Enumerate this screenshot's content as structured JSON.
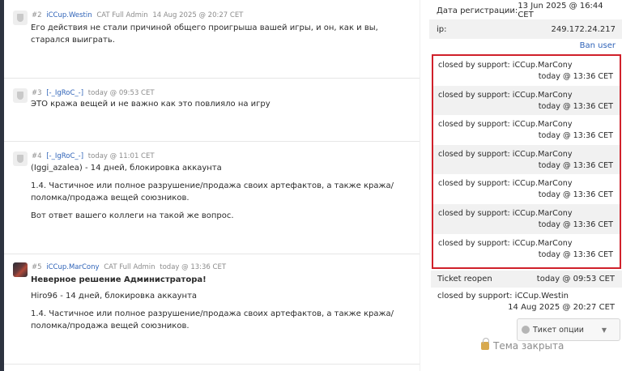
{
  "posts": [
    {
      "num": "#2",
      "author": "iCCup.Westin",
      "role": "CAT Full Admin",
      "time": "14 Aug 2025 @ 20:27 CET",
      "paragraphs": [
        "Его действия не стали причиной общего проигрыша вашей игры, и он, как и вы, старался выиграть."
      ]
    },
    {
      "num": "#3",
      "author": "[-_IgRoC_-]",
      "role": "",
      "time": "today @ 09:53 CET",
      "paragraphs": [
        "ЭТО кража вещей и не важно как это повлияло на игру"
      ]
    },
    {
      "num": "#4",
      "author": "[-_IgRoC_-]",
      "role": "",
      "time": "today @ 11:01 CET",
      "paragraphs": [
        "(Iggi_azalea) - 14 дней, блокировка аккаунта",
        "1.4. Частичное или полное разрушение/продажа своих артефактов, а также кража/поломка/продажа вещей союзников.",
        "Вот ответ вашего коллеги на такой же вопрос."
      ]
    },
    {
      "num": "#5",
      "author": "iCCup.MarCony",
      "role": "CAT Full Admin",
      "time": "today @ 13:36 CET",
      "title": "Неверное решение Администратора!",
      "paragraphs": [
        "Hiro96 - 14 дней, блокировка аккаунта",
        "1.4. Частичное или полное разрушение/продажа своих артефактов, а также кража/поломка/продажа вещей союзников."
      ]
    }
  ],
  "sidebar": {
    "reg_label": "Дата регистрации:",
    "reg_value": "13 Jun 2025 @ 16:44 CET",
    "ip_label": "ip:",
    "ip_value": "249.172.24.217",
    "ban_user": "Ban user",
    "closed_entries": [
      {
        "text": "closed by support: iCCup.MarCony",
        "time": "today @ 13:36 CET"
      },
      {
        "text": "closed by support: iCCup.MarCony",
        "time": "today @ 13:36 CET"
      },
      {
        "text": "closed by support: iCCup.MarCony",
        "time": "today @ 13:36 CET"
      },
      {
        "text": "closed by support: iCCup.MarCony",
        "time": "today @ 13:36 CET"
      },
      {
        "text": "closed by support: iCCup.MarCony",
        "time": "today @ 13:36 CET"
      },
      {
        "text": "closed by support: iCCup.MarCony",
        "time": "today @ 13:36 CET"
      },
      {
        "text": "closed by support: iCCup.MarCony",
        "time": "today @ 13:36 CET"
      }
    ],
    "reopen_text": "Ticket reopen",
    "reopen_time": "today @ 09:53 CET",
    "closed_westin_text": "closed by support: iCCup.Westin",
    "closed_westin_time": "14 Aug 2025 @ 20:27 CET",
    "ticket_options": "Тикет опции",
    "topic_closed": "Тема закрыта"
  },
  "colors": {
    "highlight_border": "#d0202a",
    "link": "#2f63b8"
  },
  "icons": [
    "shield-icon",
    "avatar-image",
    "gear-icon",
    "chevron-down-icon",
    "lock-icon"
  ]
}
